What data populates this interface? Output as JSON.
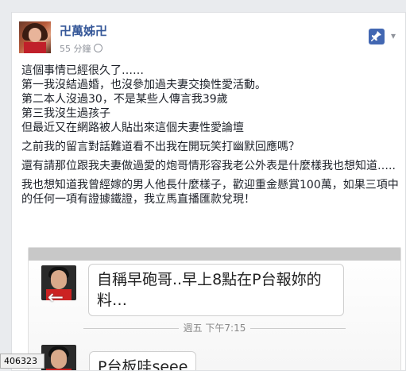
{
  "post": {
    "author": "卍萬姊卍",
    "time": "55 分鐘",
    "paragraphs": [
      [
        "這個事情已經很久了……",
        "第一我沒結過婚，也沒參加過夫妻交換性愛活動。",
        "第二本人沒過30，不是某些人傳言我39歲",
        "第三我沒生過孩子",
        "但最近又在網路被人貼出來這個夫妻性愛論壇"
      ],
      [
        "之前我的留言對話難道看不出我在開玩笑打幽默回應嗎？"
      ],
      [
        "還有請那位跟我夫妻做過愛的炮哥情形容我老公外表是什麼樣我也想知道….."
      ],
      [
        "我也想知道我曾經嫁的男人他長什麼樣子，歡迎重金懸賞100萬，如果三項中的任何一項有證據鐵證，我立馬直播匯款兌現！"
      ]
    ]
  },
  "screenshot": {
    "message1": "自稱早砲哥..早上8點在P台報妳的料…",
    "timestamp": "週五 下午7:15",
    "message2": "P台板哇seee"
  },
  "status_bar": "406323"
}
